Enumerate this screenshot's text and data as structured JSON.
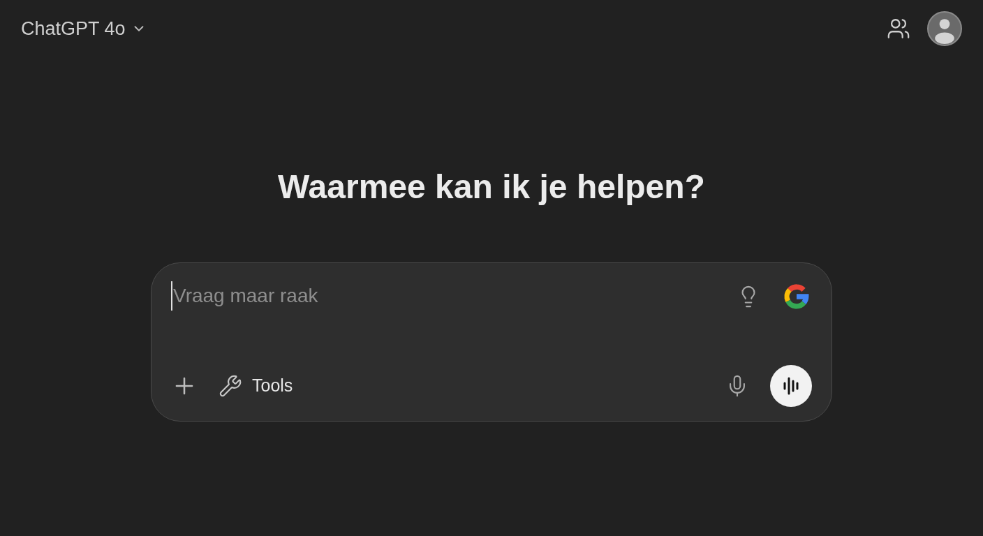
{
  "header": {
    "model": "ChatGPT 4o"
  },
  "heading": "Waarmee kan ik je helpen?",
  "composer": {
    "placeholder": "Vraag maar raak",
    "tools_label": "Tools"
  }
}
